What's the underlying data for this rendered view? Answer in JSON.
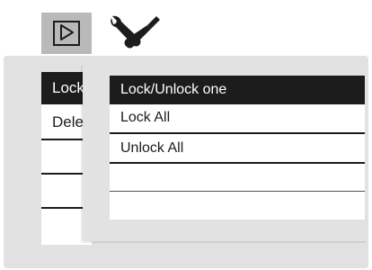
{
  "tabs": [
    {
      "icon": "playback-icon",
      "active": true
    },
    {
      "icon": "settings-wrench-screwdriver-icon",
      "active": false
    }
  ],
  "background_menu": {
    "items": [
      {
        "label": "Lock",
        "selected": true
      },
      {
        "label": "Delete",
        "selected": false
      },
      {
        "label": "",
        "selected": false
      },
      {
        "label": "",
        "selected": false
      },
      {
        "label": "",
        "selected": false
      }
    ]
  },
  "submenu": {
    "items": [
      {
        "label": "Lock/Unlock one",
        "selected": true
      },
      {
        "label": "Lock All",
        "selected": false
      },
      {
        "label": "Unlock All",
        "selected": false
      },
      {
        "label": "",
        "selected": false
      },
      {
        "label": "",
        "selected": false
      }
    ]
  },
  "colors": {
    "selection": "#1c1c1c",
    "panel": "#e1e1e1",
    "active_tab": "#b9b9b9"
  }
}
